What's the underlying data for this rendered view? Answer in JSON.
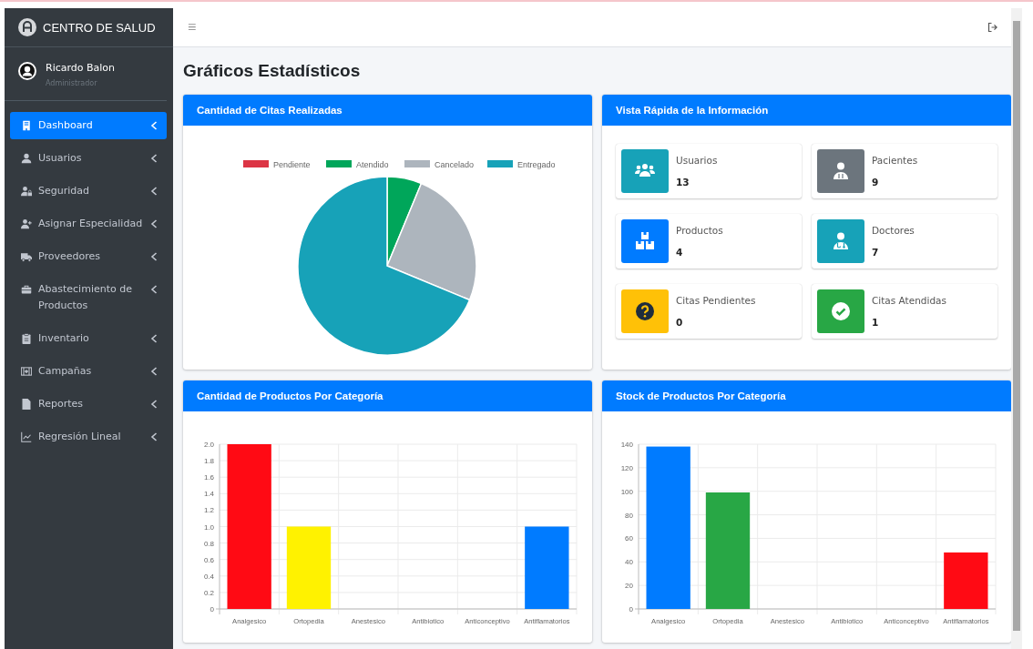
{
  "sidebar": {
    "brand": "CENTRO DE SALUD",
    "user": {
      "name": "Ricardo Balon",
      "role": "Administrador"
    },
    "items": [
      {
        "label": "Dashboard",
        "selected": true
      },
      {
        "label": "Usuarios",
        "selected": false
      },
      {
        "label": "Seguridad",
        "selected": false
      },
      {
        "label": "Asignar Especialidad",
        "selected": false
      },
      {
        "label": "Proveedores",
        "selected": false
      },
      {
        "label": "Abastecimiento de Productos",
        "selected": false
      },
      {
        "label": "Inventario",
        "selected": false
      },
      {
        "label": "Campañas",
        "selected": false
      },
      {
        "label": "Reportes",
        "selected": false
      },
      {
        "label": "Regresión Lineal",
        "selected": false
      }
    ]
  },
  "header": {
    "menu_glyph": "≡"
  },
  "page_title": "Gráficos Estadísticos",
  "panels": [
    {
      "kind": "chart",
      "title": "Cantidad de Citas Realizadas",
      "chart_data": {
        "type": "pie",
        "categories": [
          "Pendiente",
          "Atendido",
          "Cancelado",
          "Entregado"
        ],
        "colors": [
          "#dc3545",
          "#00a65a",
          "#adb5bd",
          "#17a2b8"
        ],
        "values": [
          0,
          6.25,
          25,
          68.75
        ],
        "legend": "top"
      }
    },
    {
      "kind": "stats",
      "title": "Vista Rápida de la Información",
      "boxes": [
        {
          "label": "Usuarios",
          "value": "13",
          "color": "#17a2b8"
        },
        {
          "label": "Pacientes",
          "value": "9",
          "color": "#6c757d"
        },
        {
          "label": "Productos",
          "value": "4",
          "color": "#007bff"
        },
        {
          "label": "Doctores",
          "value": "7",
          "color": "#17a2b8"
        },
        {
          "label": "Citas Pendientes",
          "value": "0",
          "color": "#ffc107"
        },
        {
          "label": "Citas Atendidas",
          "value": "1",
          "color": "#28a745"
        }
      ]
    },
    {
      "kind": "chart",
      "title": "Cantidad de Productos Por Categoría",
      "chart_data": {
        "type": "bar",
        "categories": [
          "Analgesico",
          "Ortopedia",
          "Anestesico",
          "Antibiotico",
          "Anticonceptivo",
          "Antiflamatorios"
        ],
        "colors": [
          "#ff0a14",
          "#fff200",
          null,
          null,
          null,
          "#007bff"
        ],
        "values": [
          2,
          1,
          0,
          0,
          0,
          1
        ],
        "ylim": [
          0,
          2
        ],
        "grid": true,
        "yticks": [
          {
            "value": 0,
            "label": "0"
          },
          {
            "value": 0.2,
            "label": "0.2"
          },
          {
            "value": 0.4,
            "label": "0.4"
          },
          {
            "value": 0.6,
            "label": "0.6"
          },
          {
            "value": 0.8,
            "label": "0.8"
          },
          {
            "value": 1,
            "label": "1.0"
          },
          {
            "value": 1.2,
            "label": "1.2"
          },
          {
            "value": 1.4,
            "label": "1.4"
          },
          {
            "value": 1.6,
            "label": "1.6"
          },
          {
            "value": 1.8,
            "label": "1.8"
          },
          {
            "value": 2,
            "label": "2.0"
          }
        ]
      }
    },
    {
      "kind": "chart",
      "title": "Stock de Productos Por Categoría",
      "chart_data": {
        "type": "bar",
        "categories": [
          "Analgesico",
          "Ortopedia",
          "Anestesico",
          "Antibiotico",
          "Anticonceptivo",
          "Antiflamatorios"
        ],
        "colors": [
          "#007bff",
          "#28a745",
          null,
          null,
          null,
          "#ff0a14"
        ],
        "values": [
          138,
          99,
          0,
          0,
          0,
          48
        ],
        "ylim": [
          0,
          140
        ],
        "grid": true,
        "yticks": [
          0,
          20,
          40,
          60,
          80,
          100,
          120,
          140
        ]
      }
    }
  ]
}
